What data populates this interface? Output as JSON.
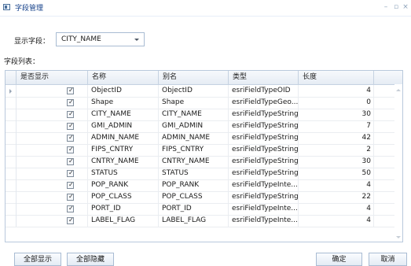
{
  "window": {
    "title": "字段管理",
    "minimize_glyph": "–",
    "maximize_glyph": "▫",
    "close_glyph": "×"
  },
  "display_field": {
    "label": "显示字段：",
    "selected": "CITY_NAME"
  },
  "field_list": {
    "label": "字段列表：",
    "columns": [
      "是否显示",
      "名称",
      "别名",
      "类型",
      "长度"
    ],
    "rows": [
      {
        "visible": true,
        "name": "ObjectID",
        "alias": "ObjectID",
        "type": "esriFieldTypeOID",
        "length": "4"
      },
      {
        "visible": true,
        "name": "Shape",
        "alias": "Shape",
        "type": "esriFieldTypeGeo...",
        "length": "0"
      },
      {
        "visible": true,
        "name": "CITY_NAME",
        "alias": "CITY_NAME",
        "type": "esriFieldTypeString",
        "length": "30"
      },
      {
        "visible": true,
        "name": "GMI_ADMIN",
        "alias": "GMI_ADMIN",
        "type": "esriFieldTypeString",
        "length": "7"
      },
      {
        "visible": true,
        "name": "ADMIN_NAME",
        "alias": "ADMIN_NAME",
        "type": "esriFieldTypeString",
        "length": "42"
      },
      {
        "visible": true,
        "name": "FIPS_CNTRY",
        "alias": "FIPS_CNTRY",
        "type": "esriFieldTypeString",
        "length": "2"
      },
      {
        "visible": true,
        "name": "CNTRY_NAME",
        "alias": "CNTRY_NAME",
        "type": "esriFieldTypeString",
        "length": "30"
      },
      {
        "visible": true,
        "name": "STATUS",
        "alias": "STATUS",
        "type": "esriFieldTypeString",
        "length": "50"
      },
      {
        "visible": true,
        "name": "POP_RANK",
        "alias": "POP_RANK",
        "type": "esriFieldTypeInte...",
        "length": "4"
      },
      {
        "visible": true,
        "name": "POP_CLASS",
        "alias": "POP_CLASS",
        "type": "esriFieldTypeString",
        "length": "22"
      },
      {
        "visible": true,
        "name": "PORT_ID",
        "alias": "PORT_ID",
        "type": "esriFieldTypeInte...",
        "length": "4"
      },
      {
        "visible": true,
        "name": "LABEL_FLAG",
        "alias": "LABEL_FLAG",
        "type": "esriFieldTypeInte...",
        "length": "4"
      }
    ]
  },
  "buttons": {
    "show_all": "全部显示",
    "hide_all": "全部隐藏",
    "ok": "确定",
    "cancel": "取消"
  },
  "check_glyph": "✓",
  "colors": {
    "title": "#14408a",
    "border": "#a9bcd3",
    "header_bg": "#e6ecf4"
  }
}
